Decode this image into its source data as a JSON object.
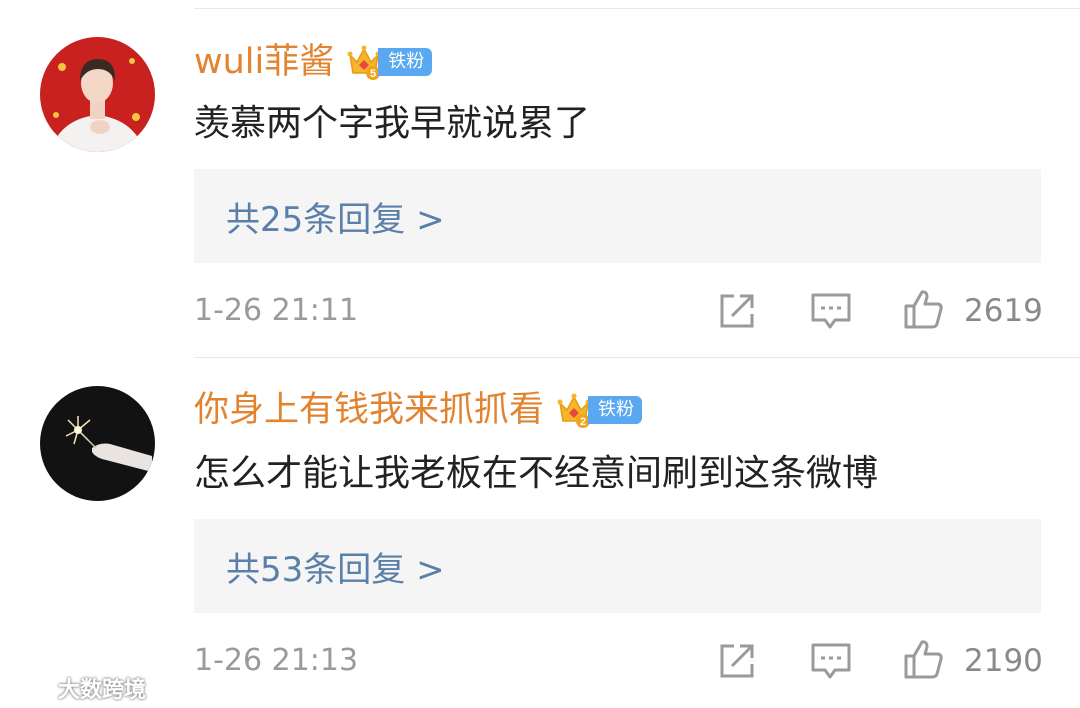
{
  "comments": [
    {
      "username": "wuli菲酱",
      "badge_level": "5",
      "badge_label": "铁粉",
      "text": "羡慕两个字我早就说累了",
      "reply_link": "共25条回复 >",
      "timestamp": "1-26 21:11",
      "like_count": "2619",
      "avatar_bg": "#c8211f"
    },
    {
      "username": "你身上有钱我来抓抓看",
      "badge_level": "2",
      "badge_label": "铁粉",
      "text": "怎么才能让我老板在不经意间刷到这条微博",
      "reply_link": "共53条回复 >",
      "timestamp": "1-26 21:13",
      "like_count": "2190",
      "avatar_bg": "#121212"
    }
  ],
  "watermark": {
    "icon": "weibo-logo-icon",
    "text": "大数跨境"
  },
  "colors": {
    "username": "#e2832f",
    "reply_link": "#5a7fa8",
    "badge": "#5aa8f0",
    "meta_text": "#9a9a9a"
  }
}
